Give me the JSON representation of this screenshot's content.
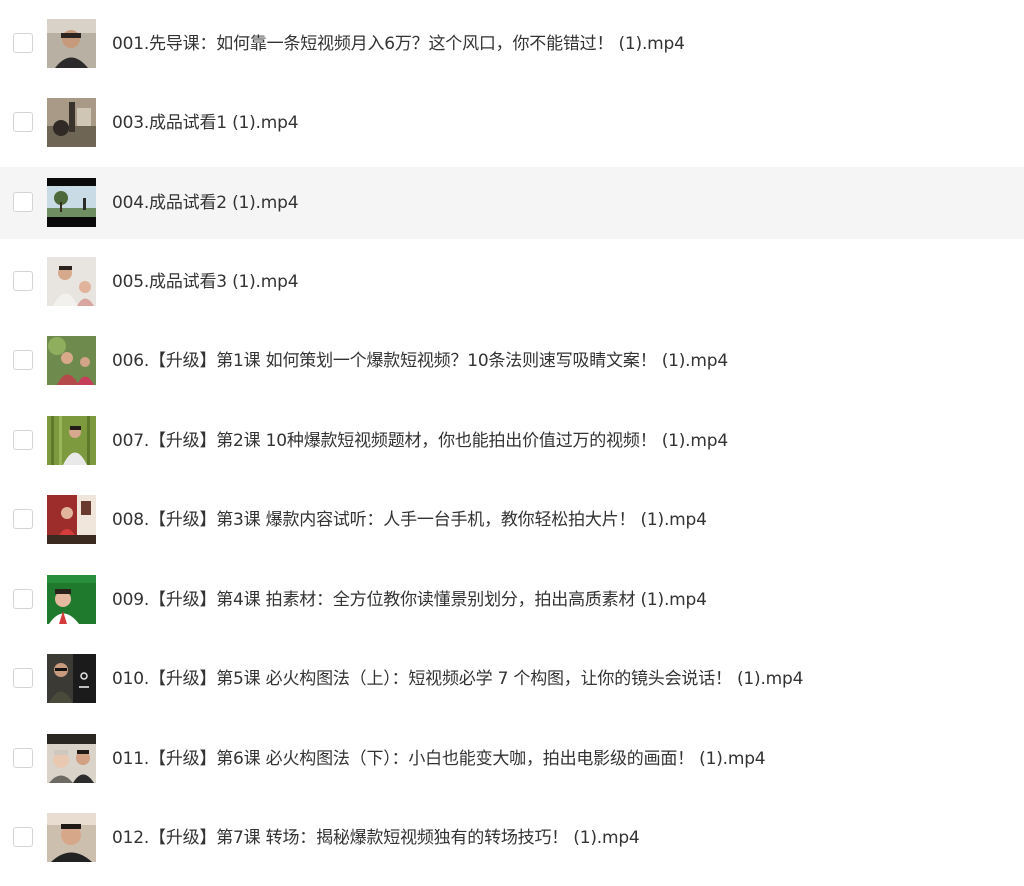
{
  "files": [
    {
      "name": "001.先导课：如何靠一条短视频月入6万？这个风口，你不能错过！ (1).mp4",
      "highlighted": false,
      "thumb_icon": "video-thumbnail-icon"
    },
    {
      "name": "003.成品试看1 (1).mp4",
      "highlighted": false,
      "thumb_icon": "video-thumbnail-icon"
    },
    {
      "name": "004.成品试看2 (1).mp4",
      "highlighted": true,
      "thumb_icon": "video-thumbnail-icon"
    },
    {
      "name": "005.成品试看3 (1).mp4",
      "highlighted": false,
      "thumb_icon": "video-thumbnail-icon"
    },
    {
      "name": "006.【升级】第1课 如何策划一个爆款短视频？10条法则速写吸睛文案！ (1).mp4",
      "highlighted": false,
      "thumb_icon": "video-thumbnail-icon"
    },
    {
      "name": "007.【升级】第2课 10种爆款短视频题材，你也能拍出价值过万的视频！ (1).mp4",
      "highlighted": false,
      "thumb_icon": "video-thumbnail-icon"
    },
    {
      "name": "008.【升级】第3课 爆款内容试听：人手一台手机，教你轻松拍大片！ (1).mp4",
      "highlighted": false,
      "thumb_icon": "video-thumbnail-icon"
    },
    {
      "name": "009.【升级】第4课 拍素材：全方位教你读懂景别划分，拍出高质素材 (1).mp4",
      "highlighted": false,
      "thumb_icon": "video-thumbnail-icon"
    },
    {
      "name": "010.【升级】第5课 必火构图法（上）：短视频必学 7 个构图，让你的镜头会说话！ (1).mp4",
      "highlighted": false,
      "thumb_icon": "video-thumbnail-icon"
    },
    {
      "name": "011.【升级】第6课 必火构图法（下）：小白也能变大咖，拍出电影级的画面！ (1).mp4",
      "highlighted": false,
      "thumb_icon": "video-thumbnail-icon"
    },
    {
      "name": "012.【升级】第7课 转场：揭秘爆款短视频独有的转场技巧！ (1).mp4",
      "highlighted": false,
      "thumb_icon": "video-thumbnail-icon"
    }
  ],
  "colors": {
    "row_highlight": "#f5f5f5",
    "text": "#333333",
    "checkbox_border": "#d4d4d4"
  }
}
